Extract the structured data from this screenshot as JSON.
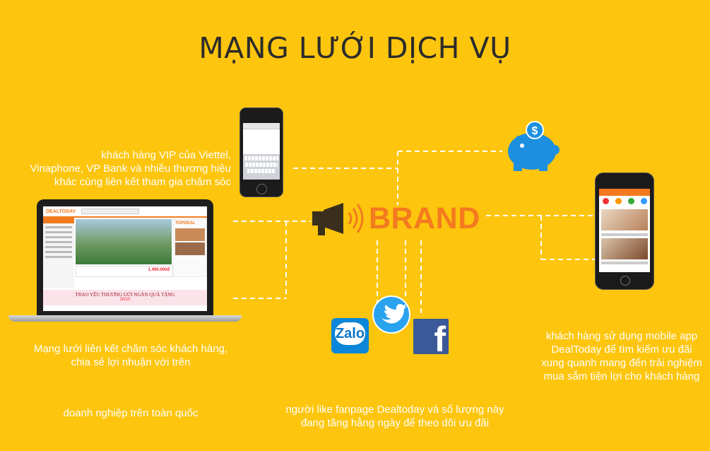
{
  "title": "MẠNG LƯỚI DỊCH VỤ",
  "brand": {
    "label": "BRAND",
    "color": "#f37a1f"
  },
  "colors": {
    "background": "#fdc50d",
    "text": "#ffffff",
    "title": "#2b2b2b"
  },
  "captions": {
    "vip": [
      "khách hàng VIP của Viettel,",
      "Vinaphone, VP Bank và nhiều thương hiệu",
      "khác cùng liên kết tham gia chăm sóc"
    ],
    "network": [
      "Mạng lưới liên kết chăm sóc khách hàng,",
      "chia sẻ lợi nhuận với trên"
    ],
    "enterprise": "doanh nghiệp trên toàn quốc",
    "fanpage": [
      "người like fanpage Dealtoday và số lượng này",
      "đang tăng hằng ngày để theo dõi ưu đãi"
    ],
    "mobile_app": [
      "khách hàng sử dụng mobile app",
      "DealToday để tìm kiếm ưu đãi",
      "xung quanh mang đến trải nghiệm",
      "mua sắm tiện lợi cho khách hàng"
    ]
  },
  "social": {
    "zalo": "Zalo",
    "facebook": "f"
  },
  "laptop_screen": {
    "logo": "DEALTODAY",
    "banner": "TRAO YÊU THƯƠNG GỬI NGÀN QUÀ TẶNG",
    "topdeal": "TOPDEAL",
    "price": "1.490.000đ",
    "date": "20/10"
  },
  "icons": [
    "megaphone-icon",
    "piggy-bank-icon",
    "dollar-icon",
    "twitter-bird-icon",
    "facebook-icon",
    "zalo-icon"
  ]
}
